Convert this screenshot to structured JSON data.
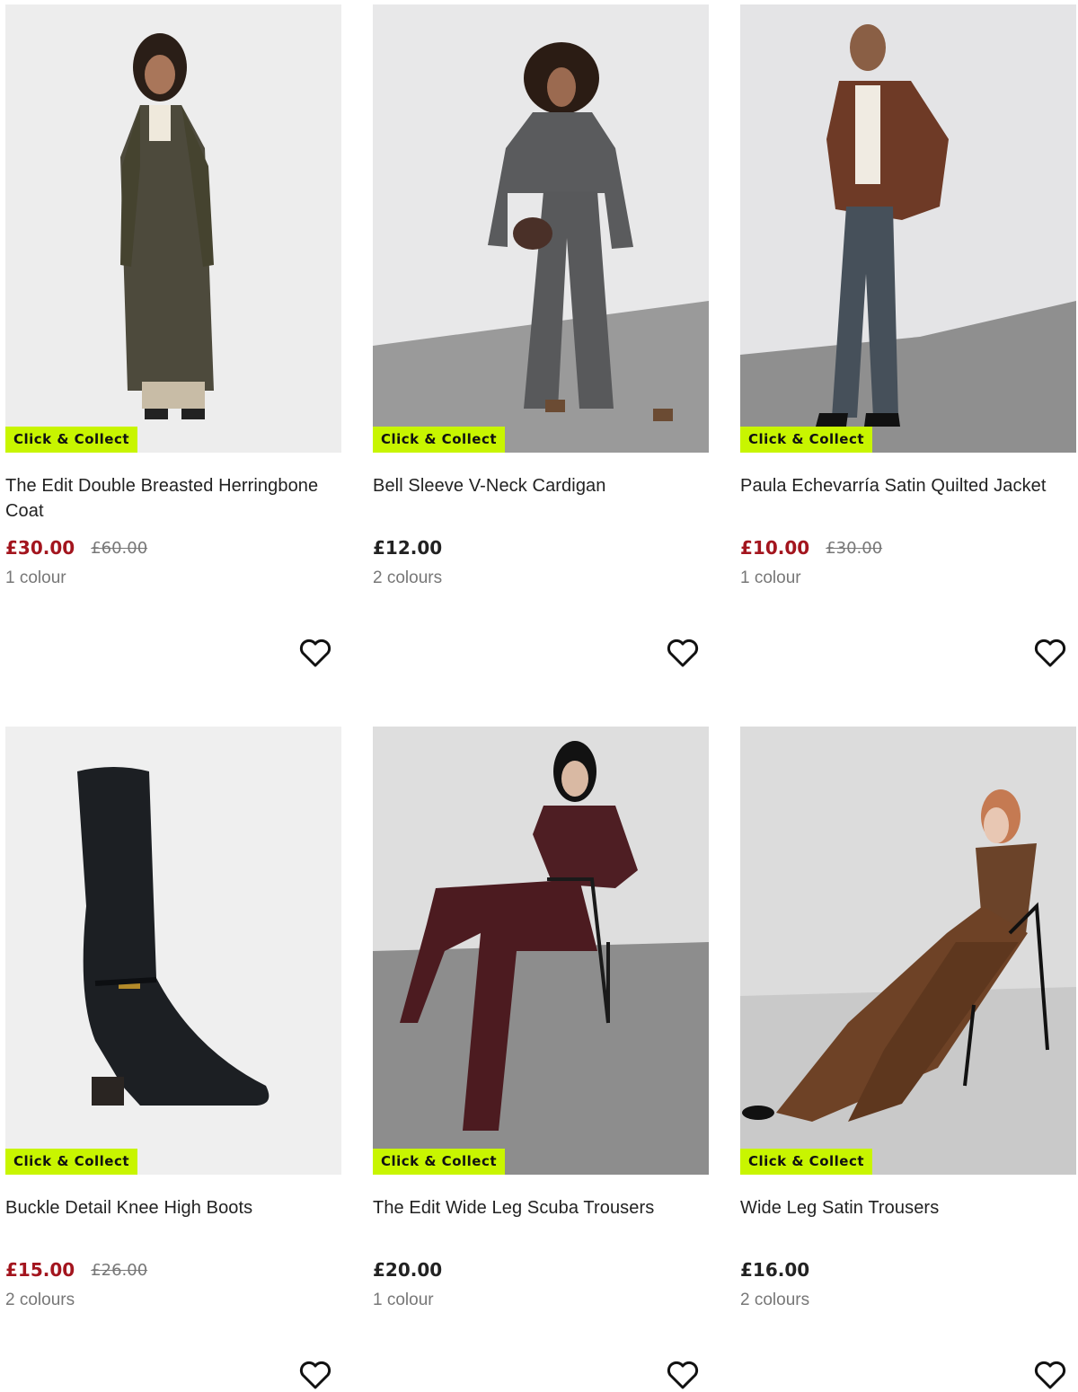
{
  "badge_label": "Click & Collect",
  "colors": {
    "badge_bg": "#c8f500",
    "sale_price": "#a3151e",
    "muted_text": "#777777"
  },
  "products": [
    {
      "title": "The Edit Double Breasted Herringbone Coat",
      "price": "£30.00",
      "was_price": "£60.00",
      "colours": "1 colour",
      "on_sale": true
    },
    {
      "title": "Bell Sleeve V-Neck Cardigan",
      "price": "£12.00",
      "was_price": "",
      "colours": "2 colours",
      "on_sale": false
    },
    {
      "title": "Paula Echevarría Satin Quilted Jacket",
      "price": "£10.00",
      "was_price": "£30.00",
      "colours": "1 colour",
      "on_sale": true
    },
    {
      "title": "Buckle Detail Knee High Boots",
      "price": "£15.00",
      "was_price": "£26.00",
      "colours": "2 colours",
      "on_sale": true
    },
    {
      "title": "The Edit Wide Leg Scuba Trousers",
      "price": "£20.00",
      "was_price": "",
      "colours": "1 colour",
      "on_sale": false
    },
    {
      "title": "Wide Leg Satin Trousers",
      "price": "£16.00",
      "was_price": "",
      "colours": "2 colours",
      "on_sale": false
    }
  ],
  "icons": {
    "wishlist": "heart-outline-icon"
  }
}
